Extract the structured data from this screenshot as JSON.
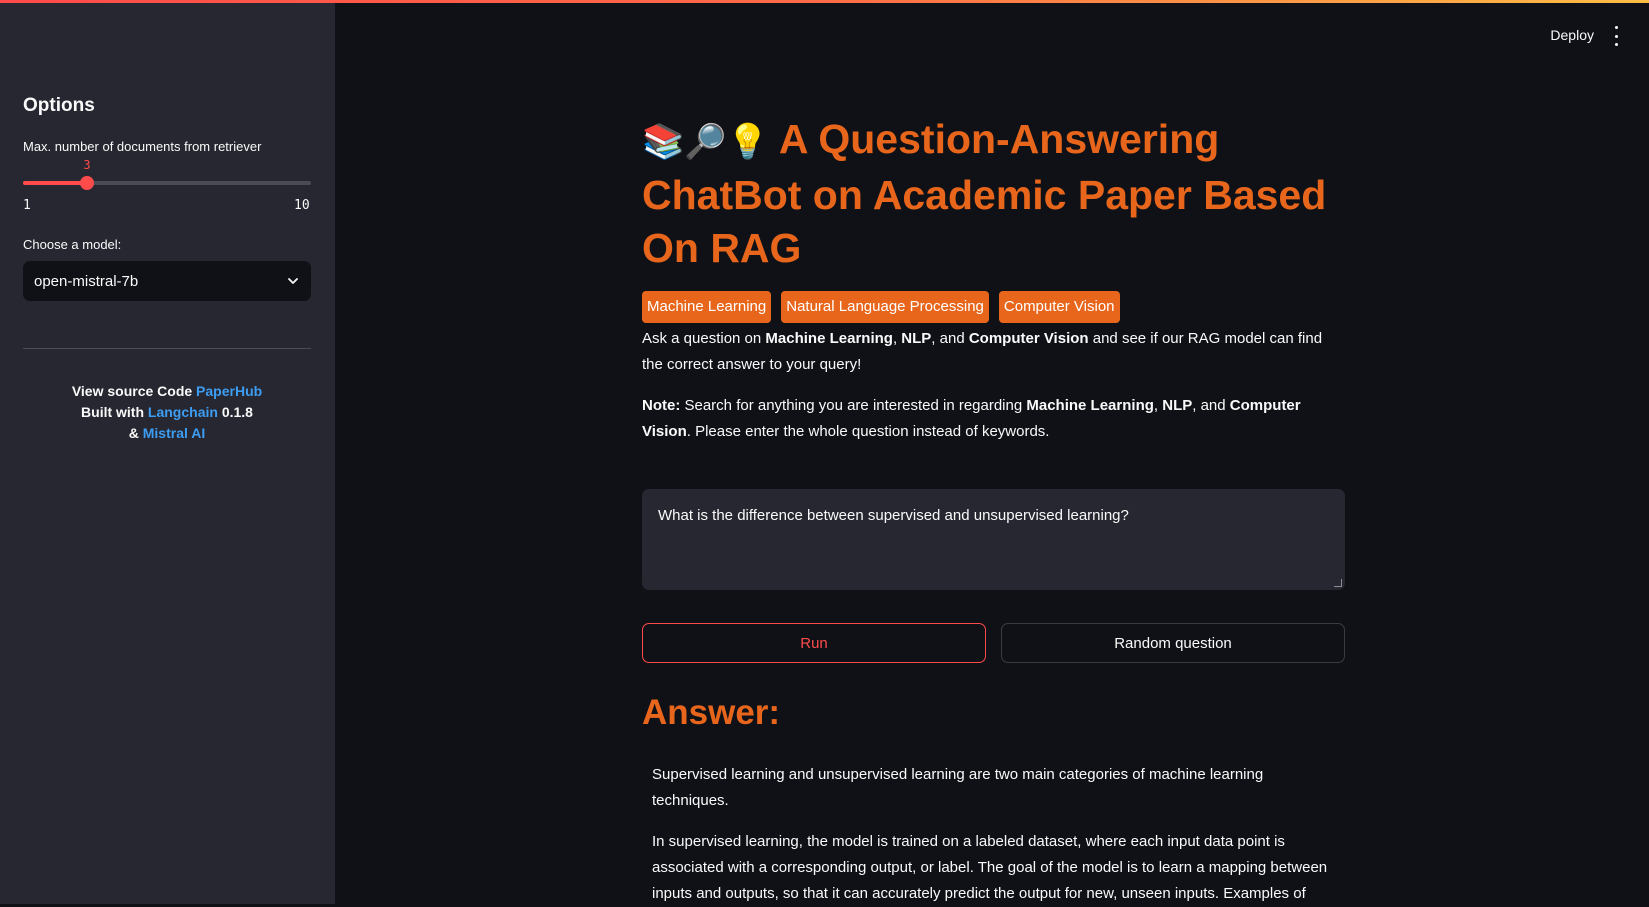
{
  "header": {
    "deploy_label": "Deploy",
    "menu_icon": "kebab-menu-icon"
  },
  "sidebar": {
    "title": "Options",
    "slider": {
      "label": "Max. number of documents from retriever",
      "value": "3",
      "min": "1",
      "max": "10"
    },
    "model": {
      "label": "Choose a model:",
      "selected": "open-mistral-7b"
    },
    "credits": {
      "line1_prefix": "View source Code ",
      "line1_link": "PaperHub",
      "line2_prefix": "Built with ",
      "line2_link": "Langchain",
      "line2_suffix": " 0.1.8",
      "line3_prefix": "& ",
      "line3_link": "Mistral AI"
    }
  },
  "main": {
    "title_emoji": "📚🔎💡",
    "title": "A Question-Answering ChatBot on Academic Paper Based On RAG",
    "tags": [
      "Machine Learning",
      "Natural Language Processing",
      "Computer Vision"
    ],
    "intro": {
      "p1": "Ask a question on ",
      "b1": "Machine Learning",
      "p2": ", ",
      "b2": "NLP",
      "p3": ", and ",
      "b3": "Computer Vision",
      "p4": " and see if our RAG model can find the correct answer to your query!"
    },
    "note": {
      "label": "Note:",
      "p1": " Search for anything you are interested in regarding ",
      "b1": "Machine Learning",
      "p2": ", ",
      "b2": "NLP",
      "p3": ", and ",
      "b3": "Computer Vision",
      "p4": ". Please enter the whole question instead of keywords."
    },
    "question": "What is the difference between supervised and unsupervised learning?",
    "run_label": "Run",
    "random_label": "Random question",
    "answer_heading": "Answer:",
    "answer_p1": "Supervised learning and unsupervised learning are two main categories of machine learning techniques.",
    "answer_p2": "In supervised learning, the model is trained on a labeled dataset, where each input data point is associated with a corresponding output, or label. The goal of the model is to learn a mapping between inputs and outputs, so that it can accurately predict the output for new, unseen inputs. Examples of"
  },
  "colors": {
    "accent": "#e8661b",
    "primary": "#ff4b4b",
    "link": "#3d9df3",
    "sidebar_bg": "#262730",
    "main_bg": "#0f1117"
  }
}
